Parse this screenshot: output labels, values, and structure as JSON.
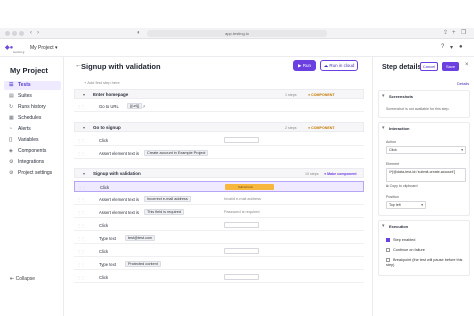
{
  "browser": {
    "url": "app.testing.io"
  },
  "topbar": {
    "logo_text": "testing",
    "project_switch": "My Project ▾"
  },
  "sidebar": {
    "title": "My Project",
    "items": [
      {
        "label": "Tests",
        "icon": "tests-icon",
        "active": true
      },
      {
        "label": "Suites",
        "icon": "suites-icon"
      },
      {
        "label": "Runs history",
        "icon": "history-icon"
      },
      {
        "label": "Schedules",
        "icon": "calendar-icon"
      },
      {
        "label": "Alerts",
        "icon": "bell-icon"
      },
      {
        "label": "Variables",
        "icon": "variables-icon"
      },
      {
        "label": "Components",
        "icon": "components-icon"
      },
      {
        "label": "Integrations",
        "icon": "integrations-icon"
      },
      {
        "label": "Project settings",
        "icon": "settings-icon"
      }
    ],
    "collapse_label": "Collapse"
  },
  "main": {
    "test_title": "Signup with validation",
    "run_label": "Run",
    "run_cloud_label": "Run in cloud",
    "add_step_hint": "+ Add first step here",
    "groups": [
      {
        "label": "Enter homepage",
        "meta": "1 steps",
        "badge": "● COMPONENT"
      },
      {
        "label": "Go to signup",
        "meta": "2 steps",
        "badge": "● COMPONENT"
      },
      {
        "label": "Signup with validation",
        "meta": "10 steps",
        "badge": "● Make component"
      }
    ],
    "rows": [
      {
        "action": "Go to URL",
        "pill": "{{url}}",
        "hint": ""
      },
      {
        "action": "Click",
        "pill": "",
        "hint": ""
      },
      {
        "action": "Assert element text is",
        "pill": "Create account in Example Project",
        "hint": ""
      },
      {
        "action": "Click",
        "pill": "",
        "hint": "Submit form"
      },
      {
        "action": "Assert element text is",
        "pill": "Incorrect e-mail address",
        "hint": "Invalid e-mail address"
      },
      {
        "action": "Assert element text is",
        "pill": "This field is required",
        "hint": "Password is required"
      },
      {
        "action": "Click",
        "pill": "",
        "hint": ""
      },
      {
        "action": "Type text",
        "pill": "test@test.com",
        "hint": ""
      },
      {
        "action": "Click",
        "pill": "",
        "hint": ""
      },
      {
        "action": "Type text",
        "pill": "Protected content",
        "hint": ""
      },
      {
        "action": "Click",
        "pill": "",
        "hint": ""
      }
    ]
  },
  "panel": {
    "title": "Step details",
    "cancel_label": "Cancel",
    "save_label": "Save",
    "details_link": "Details",
    "screenshots_head": "Screenshots",
    "screenshots_text": "Screenshot is not available for this step.",
    "interaction_head": "Interaction",
    "action_label": "Action",
    "action_value": "Click",
    "element_label": "Element",
    "element_value": "//*[@data-test-id='submit-create-account']",
    "copy_label": "Copy to clipboard",
    "position_label": "Position",
    "position_value": "Top left",
    "execution_head": "Execution",
    "step_enabled": "Step enabled",
    "continue_on_failure": "Continue on failure",
    "breakpoint": "Breakpoint (the test will pause before this step)"
  },
  "colors": {
    "accent": "#6b3fe0",
    "component": "#c47a00",
    "highlight": "#f6b73c"
  }
}
